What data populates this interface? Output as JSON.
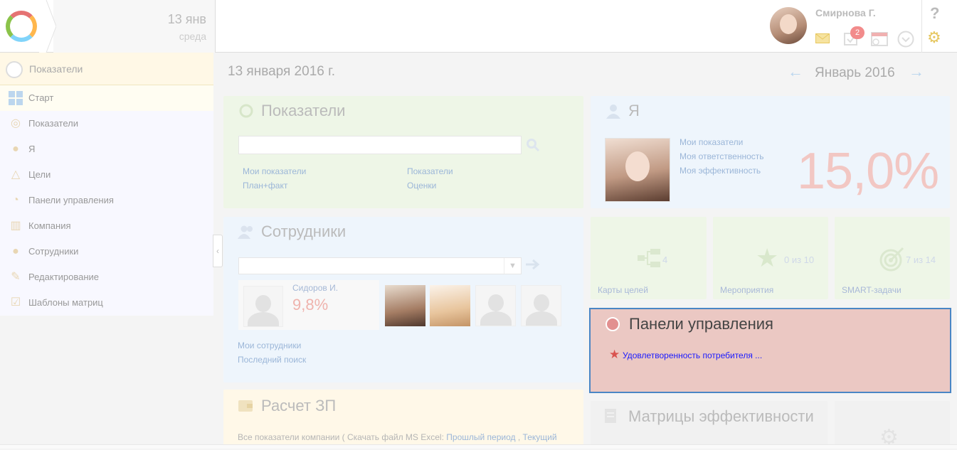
{
  "header": {
    "date_short": "13 янв",
    "weekday": "среда",
    "user_name": "Смирнова Г.",
    "notification_count": "2",
    "help": "?"
  },
  "sidebar": {
    "section_title": "Показатели",
    "items": [
      {
        "label": "Старт",
        "icon": "grid-icon"
      },
      {
        "label": "Показатели",
        "icon": "gauge-icon"
      },
      {
        "label": "Я",
        "icon": "person-icon"
      },
      {
        "label": "Цели",
        "icon": "goals-icon"
      },
      {
        "label": "Панели управления",
        "icon": "pie-icon"
      },
      {
        "label": "Компания",
        "icon": "factory-icon"
      },
      {
        "label": "Сотрудники",
        "icon": "people-icon"
      },
      {
        "label": "Редактирование",
        "icon": "edit-icon"
      },
      {
        "label": "Шаблоны матриц",
        "icon": "template-icon"
      }
    ]
  },
  "main": {
    "date": "13 января 2016 г.",
    "month": "Январь 2016"
  },
  "indicators": {
    "title": "Показатели",
    "search_value": "",
    "links": [
      "Мои показатели",
      "Показатели",
      "План+факт",
      "Оценки"
    ]
  },
  "me": {
    "title": "Я",
    "links": [
      "Мои показатели",
      "Моя ответственность",
      "Моя эффективность"
    ],
    "efficiency": "15,0%"
  },
  "employees": {
    "title": "Сотрудники",
    "select_value": "",
    "featured_name": "Сидоров И.",
    "featured_value": "9,8%",
    "links": [
      "Мои сотрудники",
      "Последний поиск"
    ]
  },
  "tiles": [
    {
      "count": "4",
      "label": "Карты целей",
      "icon": "goal-map-icon"
    },
    {
      "count": "0 из 10",
      "label": "Мероприятия",
      "icon": "star-icon"
    },
    {
      "count": "7 из 14",
      "label": "SMART-задачи",
      "icon": "target-icon"
    }
  ],
  "panels": {
    "title": "Панели управления",
    "item": "Удовлетворенность потребителя ..."
  },
  "salary": {
    "title": "Расчет ЗП",
    "text_prefix": "Все показатели компании ( Скачать файл MS Excel:",
    "link1": "Прошлый период",
    "separator": ",",
    "link2": "Текущий"
  },
  "matrices": {
    "title": "Матрицы эффективности"
  },
  "colors": {
    "accent": "#4a86c5",
    "badge": "#f28b8b",
    "panels_bg": "#ebc8c3",
    "big_value": "#f2c7c3"
  }
}
